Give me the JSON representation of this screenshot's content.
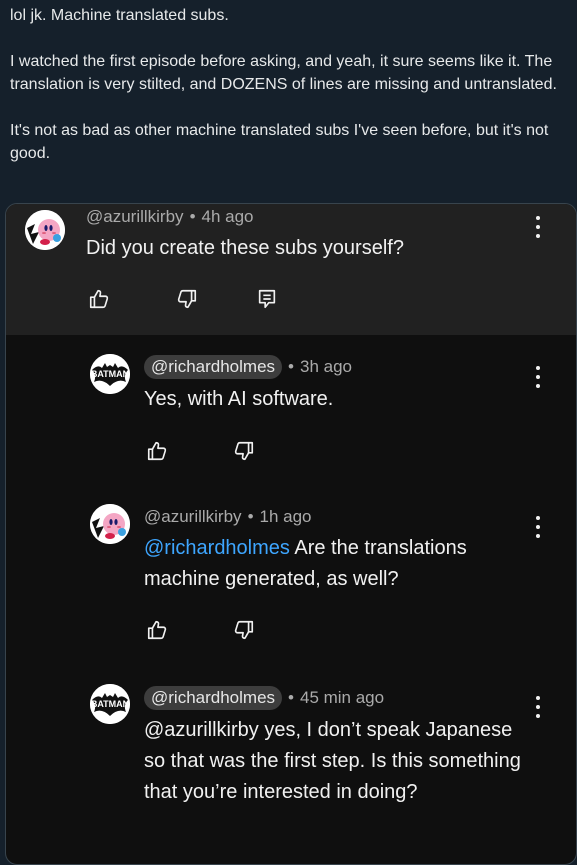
{
  "post": {
    "line1": "lol jk. Machine translated subs.",
    "line2": "I watched the first episode before asking, and yeah, it sure seems like it. The translation is very stilted, and DOZENS of lines are missing and untranslated.",
    "line3": "It's not as bad as other machine translated subs I've seen before, but it's not good."
  },
  "comments": [
    {
      "handle": "@azurillkirby",
      "time": "4h ago",
      "text": "Did you create these subs yourself?",
      "avatar_icon": "kirby-avatar",
      "actions": [
        "like-icon",
        "dislike-icon",
        "reply-icon"
      ]
    },
    {
      "handle": "@richardholmes",
      "time": "3h ago",
      "text": "Yes, with AI software.",
      "avatar_icon": "batman-avatar",
      "actions": [
        "like-icon",
        "dislike-icon"
      ]
    },
    {
      "handle": "@azurillkirby",
      "time": "1h ago",
      "mention": "@richardholmes",
      "text": " Are the translations machine generated, as well?",
      "avatar_icon": "kirby-avatar",
      "actions": [
        "like-icon",
        "dislike-icon"
      ]
    },
    {
      "handle": "@richardholmes",
      "time": "45 min ago",
      "text": "@azurillkirby yes, I don’t speak Japanese so that was the first step. Is this something that you’re interested in doing?",
      "avatar_icon": "batman-avatar"
    }
  ],
  "avatar_text": {
    "batman": "BATMAN"
  },
  "colors": {
    "background": "#15202b",
    "card_bg": "#0f0f0f",
    "top_comment_bg": "#212121",
    "mention": "#3ea6ff",
    "handle_pill": "#3d3d3d"
  }
}
